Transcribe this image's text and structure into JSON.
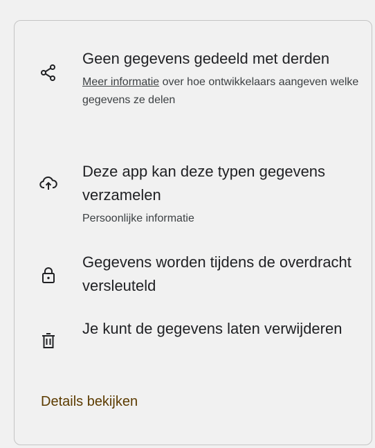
{
  "items": [
    {
      "icon": "share-icon",
      "title": "Geen gegevens gedeeld met derden",
      "link_text": "Meer informatie",
      "sub_text": " over hoe ontwikkelaars aangeven welke gegevens ze delen"
    },
    {
      "icon": "cloud-upload-icon",
      "title": "Deze app kan deze typen gegevens verzamelen",
      "sub_text": "Persoonlijke informatie"
    },
    {
      "icon": "lock-icon",
      "title": "Gegevens worden tijdens de overdracht versleuteld"
    },
    {
      "icon": "trash-icon",
      "title": "Je kunt de gegevens laten verwijderen"
    }
  ],
  "details_link": "Details bekijken",
  "colors": {
    "text": "#202124",
    "subtext": "#3c4043",
    "link_brown": "#5c3b00",
    "border": "#c4c4c4",
    "background": "#f1f1f1"
  }
}
